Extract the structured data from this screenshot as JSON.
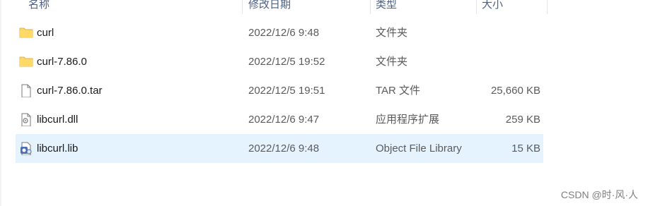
{
  "columns": {
    "name": "名称",
    "date": "修改日期",
    "type": "类型",
    "size": "大小"
  },
  "files": [
    {
      "name": "curl",
      "date": "2022/12/6 9:48",
      "type": "文件夹",
      "size": "",
      "icon": "folder-icon",
      "selected": false
    },
    {
      "name": "curl-7.86.0",
      "date": "2022/12/5 19:52",
      "type": "文件夹",
      "size": "",
      "icon": "folder-icon",
      "selected": false
    },
    {
      "name": "curl-7.86.0.tar",
      "date": "2022/12/5 19:51",
      "type": "TAR 文件",
      "size": "25,660 KB",
      "icon": "file-icon",
      "selected": false
    },
    {
      "name": "libcurl.dll",
      "date": "2022/12/6 9:47",
      "type": "应用程序扩展",
      "size": "259 KB",
      "icon": "dll-file-icon",
      "selected": false
    },
    {
      "name": "libcurl.lib",
      "date": "2022/12/6 9:48",
      "type": "Object File Library",
      "size": "15 KB",
      "icon": "lib-file-icon",
      "selected": true
    }
  ],
  "watermark": "CSDN @时·风·人",
  "colors": {
    "selection": "#e5f3ff",
    "header_text": "#4d6082",
    "folder": "#f8d775"
  }
}
